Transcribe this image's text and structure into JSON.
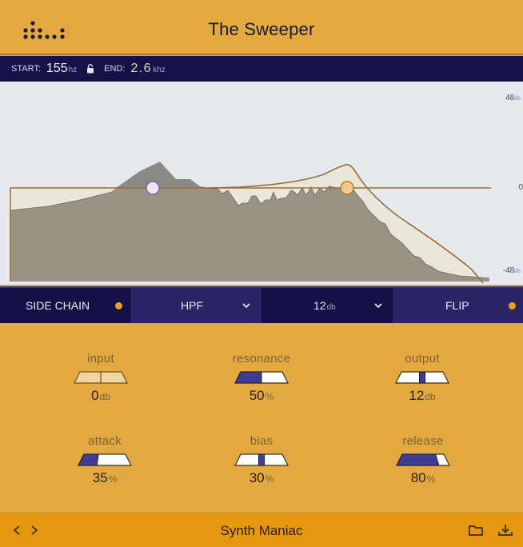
{
  "app": {
    "title": "The Sweeper",
    "logo_icon": "dot-matrix-logo-icon"
  },
  "frequency": {
    "start_label": "START:",
    "start_value": "155",
    "start_unit": "hz",
    "lock_icon": "lock-icon",
    "end_label": "END:",
    "end_value": "2.6",
    "end_unit": "khz"
  },
  "graph": {
    "db_top": "48",
    "db_mid": "0",
    "db_bottom": "-48",
    "db_unit": "db",
    "start_handle_color": "#ece6fb",
    "end_handle_color": "#f2c98a"
  },
  "toolbar": {
    "side_chain_label": "SIDE CHAIN",
    "side_chain_enabled": true,
    "filter_type": "HPF",
    "slope_value": "12",
    "slope_unit": "db",
    "flip_label": "FLIP",
    "flip_enabled": true,
    "indicator_color": "#f0a020"
  },
  "knobs": [
    {
      "name": "input",
      "value": "0",
      "unit": "db",
      "style": "bipolar",
      "position": 0.5
    },
    {
      "name": "resonance",
      "value": "50",
      "unit": "%",
      "style": "fill",
      "position": 0.5
    },
    {
      "name": "output",
      "value": "12",
      "unit": "db",
      "style": "marker",
      "position": 0.5
    },
    {
      "name": "attack",
      "value": "35",
      "unit": "%",
      "style": "fill",
      "position": 0.35
    },
    {
      "name": "bias",
      "value": "30",
      "unit": "%",
      "style": "marker",
      "position": 0.5
    },
    {
      "name": "release",
      "value": "80",
      "unit": "%",
      "style": "fill",
      "position": 0.8
    }
  ],
  "footer": {
    "preset_name": "Synth Maniac",
    "prev_icon": "chevron-left-icon",
    "next_icon": "chevron-right-icon",
    "folder_icon": "folder-icon",
    "save_icon": "download-icon"
  },
  "colors": {
    "accent_gold": "#e3a83f",
    "navy": "#131046",
    "slider_fill": "#3f3c94"
  }
}
